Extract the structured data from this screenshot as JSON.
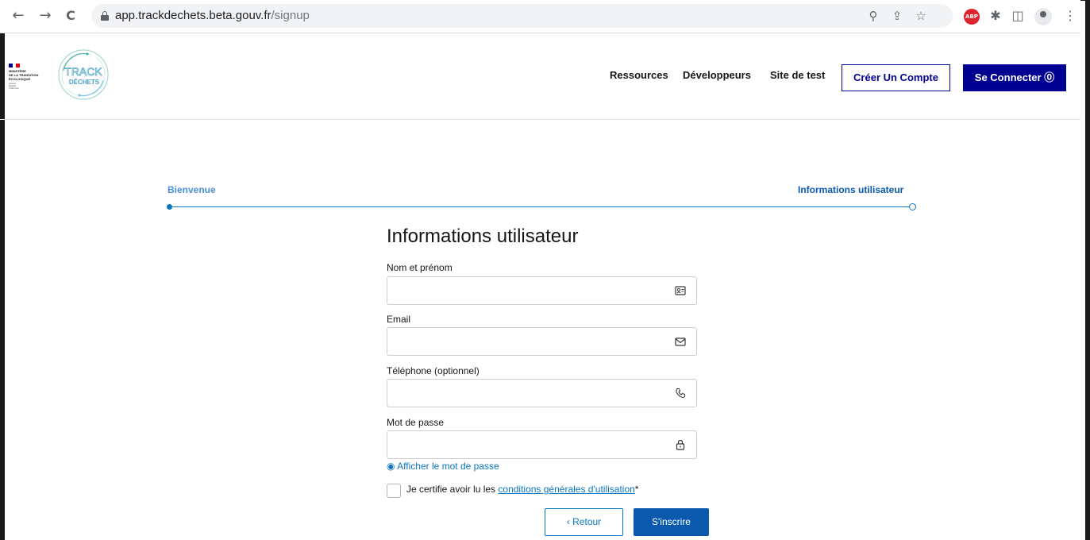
{
  "browser": {
    "url_host": "app.trackdechets.beta.gouv.fr",
    "url_path": "/signup",
    "back_icon": "←",
    "forward_icon": "→",
    "reload_icon": "C",
    "zoom_icon": "⚲",
    "share_icon": "⇪",
    "star_icon": "☆",
    "abp_label": "ABP",
    "extensions_icon": "✱",
    "sidepanel_icon": "◫",
    "menu_icon": "⋮"
  },
  "header": {
    "ministry_lines": [
      "MINISTÈRE",
      "DE LA TRANSITION",
      "ÉCOLOGIQUE"
    ],
    "devise_lines": [
      "Liberté",
      "Égalité",
      "Fraternité"
    ],
    "logo_top": "TRACK",
    "logo_bottom": "DÉCHETS",
    "nav": [
      "Ressources",
      "Développeurs",
      "Site de test"
    ],
    "create_account": "Créer Un Compte",
    "login": "Se Connecter ⓪",
    "colors": {
      "primary": "#000091",
      "flag_blue": "#000091",
      "flag_red": "#e1000f"
    }
  },
  "stepper": {
    "step1": "Bienvenue",
    "step2": "Informations utilisateur",
    "colors": {
      "done": "#4a90d9",
      "active": "#0a59ad"
    }
  },
  "form": {
    "title": "Informations utilisateur",
    "fields": [
      {
        "label": "Nom et prénom",
        "value": "",
        "icon": "🪪"
      },
      {
        "label": "Email",
        "value": "",
        "icon": "✉"
      },
      {
        "label": "Téléphone (optionnel)",
        "value": "",
        "icon": "✆"
      },
      {
        "label": "Mot de passe",
        "value": "",
        "icon": "🔒"
      }
    ],
    "show_password": "◉ Afficher le mot de passe",
    "cgu_prefix": "Je certifie avoir lu les ",
    "cgu_link": "conditions générales d'utilisation",
    "cgu_suffix": "*",
    "back_button": "‹  Retour",
    "submit_button": "S'inscrire"
  }
}
